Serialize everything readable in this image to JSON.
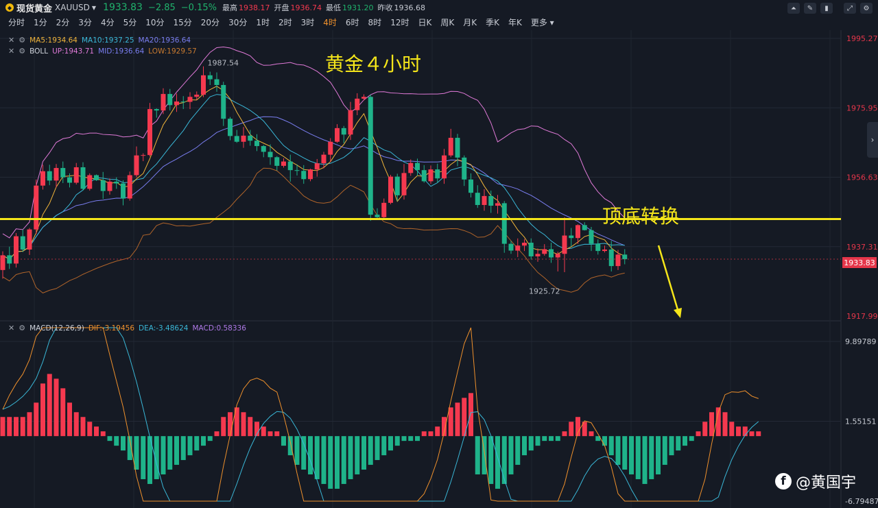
{
  "header": {
    "symbol_name": "现货黄金",
    "symbol_code": "XAUUSD",
    "last_price": "1933.83",
    "change": "−2.85",
    "change_pct": "−0.15%",
    "high_label": "最高",
    "high": "1938.17",
    "open_label": "开盘",
    "open": "1936.74",
    "low_label": "最低",
    "low": "1931.20",
    "prev_label": "昨收",
    "prev": "1936.68"
  },
  "periods": [
    "分时",
    "1分",
    "2分",
    "3分",
    "4分",
    "5分",
    "10分",
    "15分",
    "20分",
    "30分",
    "1时",
    "2时",
    "3时",
    "4时",
    "6时",
    "8时",
    "12时",
    "日K",
    "周K",
    "月K",
    "季K",
    "年K",
    "更多"
  ],
  "active_period": "4时",
  "indicators": {
    "ma": {
      "ma5": "MA5:1934.64",
      "ma10": "MA10:1937.25",
      "ma20": "MA20:1936.64"
    },
    "boll": {
      "name": "BOLL",
      "up": "UP:1943.71",
      "mid": "MID:1936.64",
      "low": "LOW:1929.57"
    },
    "macd": {
      "name": "MACD(12,26,9)",
      "dif": "DIF:-3.19456",
      "dea": "DEA:-3.48624",
      "macd": "MACD:0.58336"
    }
  },
  "price_axis": [
    "1995.27",
    "1975.95",
    "1956.63",
    "1937.31",
    "1917.99"
  ],
  "macd_axis": [
    "9.89789",
    "1.55151",
    "-6.79487"
  ],
  "current_price_tag": "1933.83",
  "chart_labels": {
    "high_mark": "1987.54",
    "low_mark": "1925.72"
  },
  "annotations": {
    "title": "黄金４小时",
    "switch": "顶底转换"
  },
  "watermark": "@黄国宇",
  "colors": {
    "up": "#f5394f",
    "down": "#1fb38a",
    "ma5": "#f0b43a",
    "ma10": "#3ab8d8",
    "ma20": "#7a7ef0",
    "boll_up": "#e07ad8",
    "boll_low": "#b0642a",
    "dif": "#f0912c",
    "dea": "#3ab8d8",
    "macd": "#b07ae8",
    "support": "#f5e61a"
  },
  "chart_data": {
    "type": "candlestick",
    "price_ylim": [
      1917.99,
      1995.27
    ],
    "support_level": 1945.0,
    "candles": [
      [
        1930.8,
        1934.9,
        1928.4,
        1936.0
      ],
      [
        1934.9,
        1932.6,
        1931.1,
        1937.3
      ],
      [
        1932.6,
        1940.2,
        1931.5,
        1941.1
      ],
      [
        1940.2,
        1936.5,
        1935.8,
        1942.1
      ],
      [
        1936.5,
        1942.1,
        1935.0,
        1942.5
      ],
      [
        1942.1,
        1954.3,
        1940.8,
        1956.0
      ],
      [
        1954.3,
        1958.3,
        1953.2,
        1960.1
      ],
      [
        1958.3,
        1955.7,
        1954.4,
        1960.1
      ],
      [
        1955.7,
        1959.2,
        1953.8,
        1960.3
      ],
      [
        1959.2,
        1956.6,
        1955.0,
        1961.0
      ],
      [
        1956.6,
        1955.1,
        1953.8,
        1957.7
      ],
      [
        1955.1,
        1959.4,
        1954.6,
        1960.6
      ],
      [
        1959.4,
        1953.4,
        1952.9,
        1960.8
      ],
      [
        1953.4,
        1957.2,
        1952.9,
        1957.7
      ],
      [
        1957.2,
        1955.8,
        1955.6,
        1957.4
      ],
      [
        1955.8,
        1952.8,
        1950.6,
        1958.1
      ],
      [
        1952.8,
        1955.4,
        1951.8,
        1956.3
      ],
      [
        1955.4,
        1954.9,
        1953.4,
        1956.6
      ],
      [
        1954.9,
        1950.7,
        1948.8,
        1955.8
      ],
      [
        1950.7,
        1957.2,
        1950.1,
        1958.2
      ],
      [
        1957.2,
        1962.7,
        1956.6,
        1965.2
      ],
      [
        1962.7,
        1962.8,
        1961.1,
        1963.3
      ],
      [
        1962.8,
        1975.6,
        1962.4,
        1977.3
      ],
      [
        1975.6,
        1975.2,
        1973.2,
        1975.8
      ],
      [
        1975.2,
        1979.8,
        1974.2,
        1981.4
      ],
      [
        1979.8,
        1976.7,
        1975.2,
        1981.2
      ],
      [
        1976.7,
        1977.7,
        1974.8,
        1979.9
      ],
      [
        1977.7,
        1977.6,
        1975.6,
        1979.2
      ],
      [
        1977.6,
        1979.0,
        1975.6,
        1980.3
      ],
      [
        1979.0,
        1979.6,
        1978.2,
        1980.5
      ],
      [
        1979.6,
        1985.0,
        1978.9,
        1987.5
      ],
      [
        1985.0,
        1983.9,
        1982.3,
        1986.0
      ],
      [
        1983.9,
        1982.3,
        1980.4,
        1985.8
      ],
      [
        1982.3,
        1972.9,
        1970.9,
        1983.2
      ],
      [
        1972.9,
        1968.1,
        1966.9,
        1973.4
      ],
      [
        1968.1,
        1966.5,
        1966.2,
        1969.8
      ],
      [
        1966.5,
        1968.2,
        1964.8,
        1970.6
      ],
      [
        1968.2,
        1966.8,
        1965.4,
        1969.8
      ],
      [
        1966.8,
        1965.3,
        1963.9,
        1968.6
      ],
      [
        1965.3,
        1963.7,
        1962.2,
        1965.6
      ],
      [
        1963.7,
        1962.2,
        1960.1,
        1965.8
      ],
      [
        1962.2,
        1959.8,
        1958.5,
        1962.5
      ],
      [
        1959.8,
        1961.0,
        1959.3,
        1961.9
      ],
      [
        1961.0,
        1958.6,
        1955.4,
        1962.9
      ],
      [
        1958.6,
        1958.4,
        1957.1,
        1960.2
      ],
      [
        1958.4,
        1956.1,
        1954.8,
        1960.0
      ],
      [
        1956.1,
        1958.8,
        1955.5,
        1959.0
      ],
      [
        1958.8,
        1960.5,
        1956.8,
        1961.7
      ],
      [
        1960.5,
        1962.9,
        1959.1,
        1963.7
      ],
      [
        1962.9,
        1966.5,
        1960.9,
        1967.5
      ],
      [
        1966.5,
        1970.3,
        1966.2,
        1971.4
      ],
      [
        1970.3,
        1968.5,
        1966.1,
        1970.9
      ],
      [
        1968.5,
        1975.3,
        1967.0,
        1977.6
      ],
      [
        1975.3,
        1978.5,
        1973.9,
        1980.0
      ],
      [
        1978.5,
        1979.0,
        1978.0,
        1979.7
      ],
      [
        1979.0,
        1946.2,
        1944.5,
        1979.6
      ],
      [
        1946.2,
        1945.5,
        1944.7,
        1948.0
      ],
      [
        1945.5,
        1949.5,
        1944.9,
        1950.7
      ],
      [
        1949.5,
        1956.8,
        1949.1,
        1957.3
      ],
      [
        1956.8,
        1951.6,
        1950.0,
        1957.6
      ],
      [
        1951.6,
        1957.8,
        1950.4,
        1960.3
      ],
      [
        1957.8,
        1960.6,
        1957.0,
        1961.6
      ],
      [
        1960.6,
        1958.6,
        1957.0,
        1961.8
      ],
      [
        1958.6,
        1955.5,
        1955.1,
        1960.0
      ],
      [
        1955.5,
        1958.8,
        1954.8,
        1959.9
      ],
      [
        1958.8,
        1956.3,
        1955.1,
        1960.4
      ],
      [
        1956.3,
        1962.7,
        1954.8,
        1964.5
      ],
      [
        1962.7,
        1967.6,
        1962.2,
        1970.1
      ],
      [
        1967.6,
        1962.1,
        1959.7,
        1968.7
      ],
      [
        1962.1,
        1956.0,
        1954.2,
        1962.7
      ],
      [
        1956.0,
        1952.3,
        1951.0,
        1957.7
      ],
      [
        1952.3,
        1948.9,
        1948.1,
        1954.4
      ],
      [
        1948.9,
        1951.4,
        1947.3,
        1953.3
      ],
      [
        1951.4,
        1948.7,
        1946.7,
        1952.9
      ],
      [
        1948.7,
        1949.4,
        1946.5,
        1951.7
      ],
      [
        1949.4,
        1938.1,
        1935.6,
        1950.0
      ],
      [
        1938.1,
        1936.2,
        1935.3,
        1938.9
      ],
      [
        1936.2,
        1937.6,
        1934.4,
        1939.6
      ],
      [
        1937.6,
        1938.4,
        1936.1,
        1939.4
      ],
      [
        1938.4,
        1934.6,
        1933.7,
        1939.6
      ],
      [
        1934.6,
        1935.3,
        1933.1,
        1936.8
      ],
      [
        1935.3,
        1936.6,
        1934.8,
        1938.0
      ],
      [
        1936.6,
        1934.3,
        1932.8,
        1938.4
      ],
      [
        1934.3,
        1935.3,
        1930.4,
        1935.9
      ],
      [
        1935.3,
        1940.4,
        1930.2,
        1945.5
      ],
      [
        1940.4,
        1939.7,
        1937.3,
        1942.5
      ],
      [
        1939.7,
        1943.3,
        1938.1,
        1943.5
      ],
      [
        1943.3,
        1941.9,
        1941.8,
        1944.1
      ],
      [
        1941.9,
        1938.1,
        1936.1,
        1942.8
      ],
      [
        1938.1,
        1936.1,
        1935.1,
        1939.3
      ],
      [
        1936.1,
        1936.5,
        1935.7,
        1937.6
      ],
      [
        1936.5,
        1931.9,
        1930.4,
        1938.9
      ],
      [
        1931.9,
        1935.1,
        1930.8,
        1936.4
      ],
      [
        1935.1,
        1933.8,
        1932.4,
        1936.6
      ]
    ],
    "macd_ylim": [
      -6.79487,
      9.89789
    ],
    "macd_hist": [
      2.0,
      2.0,
      2.0,
      2.0,
      2.5,
      3.5,
      5.5,
      6.5,
      6.0,
      5.0,
      3.5,
      2.5,
      2.0,
      1.5,
      1.0,
      0.5,
      -0.5,
      -1.0,
      -1.5,
      -2.5,
      -3.5,
      -4.5,
      -5.0,
      -4.5,
      -4.0,
      -3.5,
      -3.0,
      -2.5,
      -2.0,
      -1.5,
      -1.0,
      -0.5,
      0.5,
      2.0,
      2.5,
      3.0,
      2.5,
      2.0,
      1.5,
      1.0,
      0.5,
      0.5,
      -1.0,
      -2.0,
      -3.0,
      -3.5,
      -4.0,
      -4.5,
      -5.0,
      -5.5,
      -5.5,
      -5.0,
      -4.5,
      -4.0,
      -3.5,
      -3.0,
      -2.5,
      -2.0,
      -1.5,
      -1.0,
      -0.5,
      -0.5,
      -0.5,
      0.5,
      0.5,
      1.0,
      2.0,
      3.0,
      3.5,
      4.0,
      4.5,
      -4.0,
      -4.0,
      -5.0,
      -5.5,
      -5.0,
      -4.0,
      -3.0,
      -2.0,
      -1.5,
      -1.0,
      -0.5,
      -0.5,
      -0.5,
      0.5,
      1.5,
      2.0,
      1.5,
      0.5,
      -0.5,
      -1.0,
      -2.0,
      -3.0,
      -3.5,
      -4.0,
      -4.5,
      -5.0,
      -4.5,
      -4.0,
      -3.0,
      -2.0,
      -1.5,
      -1.0,
      -0.5,
      0.5,
      1.5,
      2.5,
      3.0,
      2.5,
      1.5,
      1.0,
      1.0,
      0.5,
      0.5
    ]
  }
}
